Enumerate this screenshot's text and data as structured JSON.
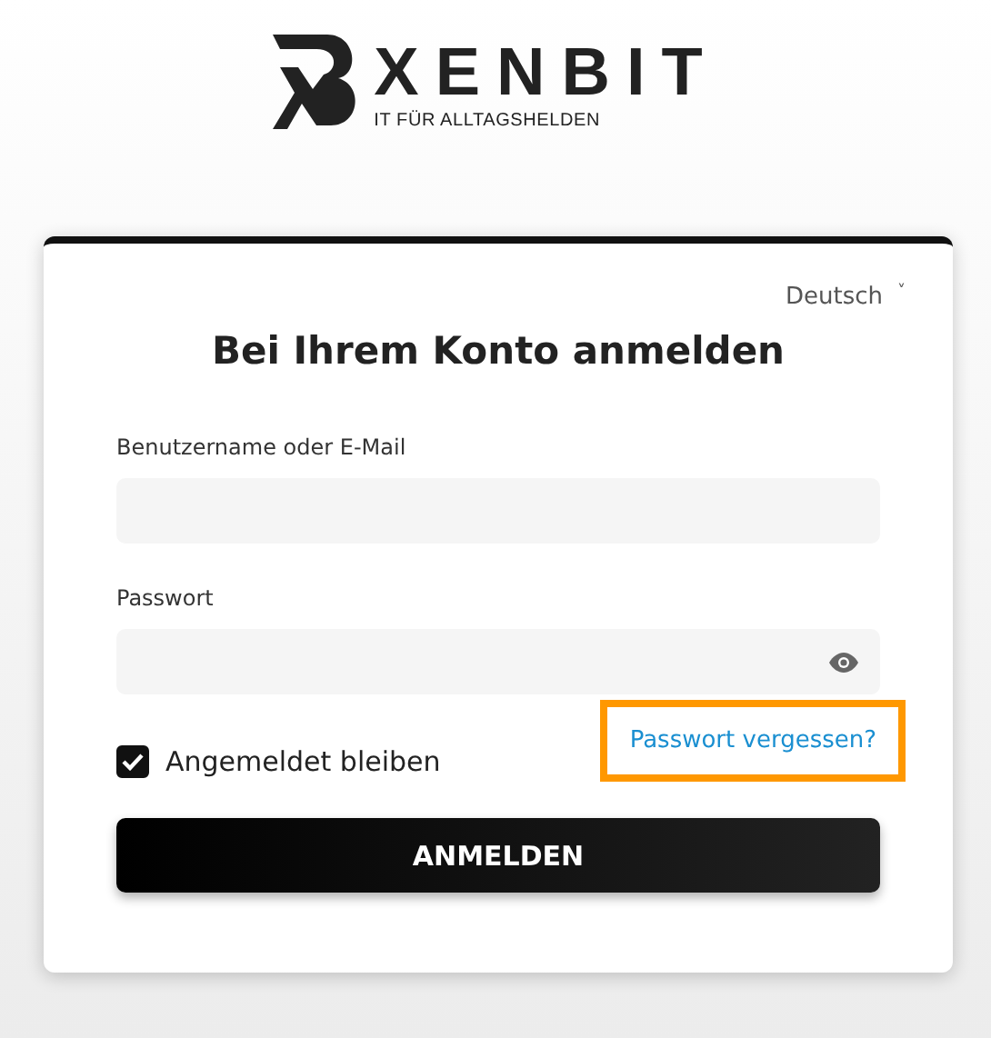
{
  "logo": {
    "name": "XENBIT",
    "tagline": "IT FÜR ALLTAGSHELDEN"
  },
  "login": {
    "language": "Deutsch",
    "language_caret": "˅",
    "title": "Bei Ihrem Konto anmelden",
    "fields": [
      {
        "kind": "text",
        "label": "Benutzername oder E-Mail"
      },
      {
        "kind": "password",
        "label": "Passwort"
      }
    ],
    "remember": {
      "label": "Angemeldet bleiben",
      "checked": true
    },
    "forgot": {
      "label": "Passwort vergessen?",
      "highlighted": true
    },
    "submit": "ANMELDEN"
  }
}
